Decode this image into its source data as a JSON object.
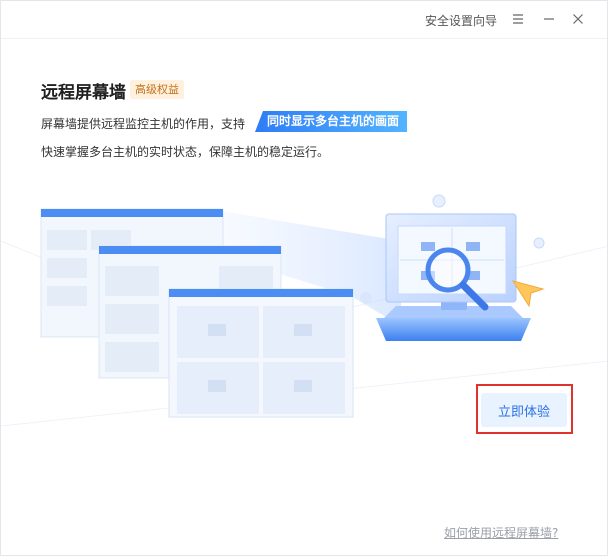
{
  "titlebar": {
    "wizard_label": "安全设置向导",
    "menu_icon": "menu-icon",
    "minimize_icon": "minimize-icon",
    "close_icon": "close-icon"
  },
  "feature": {
    "title": "远程屏幕墙",
    "tag": "高级权益",
    "description_prefix": "屏幕墙提供远程监控主机的作用，支持",
    "highlight": "同时显示多台主机的画面",
    "description_line2": "快速掌握多台主机的实时状态，保障主机的稳定运行。"
  },
  "actions": {
    "try_now": "立即体验",
    "help_link": "如何使用远程屏幕墙?"
  },
  "colors": {
    "accent": "#2a72e5",
    "highlight_start": "#2f7cf5",
    "highlight_end": "#52b4ff",
    "tag_text": "#c2711a",
    "tag_bg": "#fff1de",
    "annotation_red": "#e0332e"
  },
  "illustration": {
    "screens_icon": "screen-wall-illustration",
    "monitor_icon": "magnifier-monitor-illustration",
    "cursor_icon": "cursor-arrow-icon"
  }
}
